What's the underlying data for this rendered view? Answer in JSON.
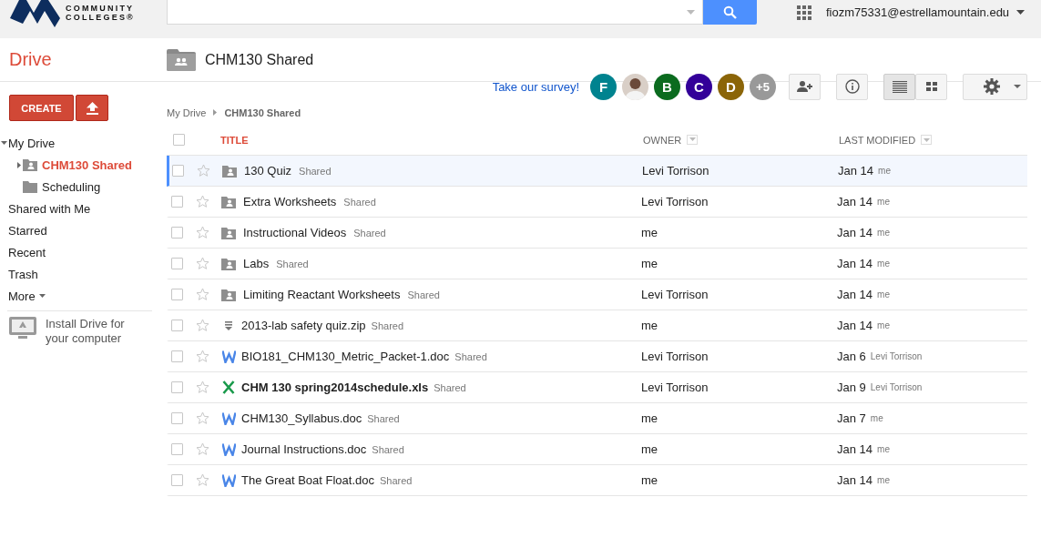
{
  "header": {
    "logo_lines": [
      "COMMUNITY",
      "COLLEGES®"
    ],
    "account": "fiozm75331@estrellamountain.edu"
  },
  "app_title": "Drive",
  "folder_title": "CHM130 Shared",
  "sidebar": {
    "create_label": "CREATE",
    "items": [
      {
        "label": "My Drive",
        "kind": "link",
        "selected": false,
        "expanded": true,
        "children": [
          {
            "label": "CHM130 Shared",
            "kind": "shared-folder",
            "selected": true,
            "expanded": false
          },
          {
            "label": "Scheduling",
            "kind": "folder",
            "selected": false
          }
        ]
      },
      {
        "label": "Shared with Me",
        "kind": "link",
        "selected": false
      },
      {
        "label": "Starred",
        "kind": "link",
        "selected": false
      },
      {
        "label": "Recent",
        "kind": "link",
        "selected": false
      },
      {
        "label": "Trash",
        "kind": "link",
        "selected": false
      },
      {
        "label": "More",
        "kind": "menu",
        "selected": false
      }
    ],
    "install_text": "Install Drive for your computer"
  },
  "toolbar": {
    "survey_link": "Take our survey!",
    "avatars": [
      {
        "kind": "letter",
        "label": "F",
        "color": "#00838f"
      },
      {
        "kind": "photo"
      },
      {
        "kind": "letter",
        "label": "B",
        "color": "#0b6b1f"
      },
      {
        "kind": "letter",
        "label": "C",
        "color": "#330099"
      },
      {
        "kind": "letter",
        "label": "D",
        "color": "#8b6508"
      },
      {
        "kind": "more",
        "label": "+5"
      }
    ],
    "view_modes": [
      {
        "kind": "list",
        "selected": true
      },
      {
        "kind": "grid",
        "selected": false
      }
    ]
  },
  "breadcrumb": [
    "My Drive",
    "CHM130 Shared"
  ],
  "table": {
    "select_all_checked": false,
    "columns": [
      {
        "label": "TITLE",
        "sorted": true
      },
      {
        "label": "OWNER",
        "sorted": false
      },
      {
        "label": "LAST MODIFIED",
        "sorted": false
      }
    ],
    "rows": [
      {
        "kind": "shared-folder",
        "title": "130 Quiz",
        "badge": "Shared",
        "owner": "Levi Torrison",
        "date": "Jan 14",
        "modifier": "me",
        "selected": true,
        "checked": false,
        "starred": false,
        "unread": false
      },
      {
        "kind": "shared-folder",
        "title": "Extra Worksheets",
        "badge": "Shared",
        "owner": "Levi Torrison",
        "date": "Jan 14",
        "modifier": "me",
        "selected": false,
        "checked": false,
        "starred": false,
        "unread": false
      },
      {
        "kind": "shared-folder",
        "title": "Instructional Videos",
        "badge": "Shared",
        "owner": "me",
        "date": "Jan 14",
        "modifier": "me",
        "selected": false,
        "checked": false,
        "starred": false,
        "unread": false
      },
      {
        "kind": "shared-folder",
        "title": "Labs",
        "badge": "Shared",
        "owner": "me",
        "date": "Jan 14",
        "modifier": "me",
        "selected": false,
        "checked": false,
        "starred": false,
        "unread": false
      },
      {
        "kind": "shared-folder",
        "title": "Limiting Reactant Worksheets",
        "badge": "Shared",
        "owner": "Levi Torrison",
        "date": "Jan 14",
        "modifier": "me",
        "selected": false,
        "checked": false,
        "starred": false,
        "unread": false
      },
      {
        "kind": "zip",
        "title": "2013-lab safety quiz.zip",
        "badge": "Shared",
        "owner": "me",
        "date": "Jan 14",
        "modifier": "me",
        "selected": false,
        "checked": false,
        "starred": false,
        "unread": false
      },
      {
        "kind": "doc",
        "title": "BIO181_CHM130_Metric_Packet-1.doc",
        "badge": "Shared",
        "owner": "Levi Torrison",
        "date": "Jan 6",
        "modifier": "Levi Torrison",
        "selected": false,
        "checked": false,
        "starred": false,
        "unread": false
      },
      {
        "kind": "sheet",
        "title": "CHM 130 spring2014schedule.xls",
        "badge": "Shared",
        "owner": "Levi Torrison",
        "date": "Jan 9",
        "modifier": "Levi Torrison",
        "selected": false,
        "checked": false,
        "starred": false,
        "unread": true
      },
      {
        "kind": "doc",
        "title": "CHM130_Syllabus.doc",
        "badge": "Shared",
        "owner": "me",
        "date": "Jan 7",
        "modifier": "me",
        "selected": false,
        "checked": false,
        "starred": false,
        "unread": false
      },
      {
        "kind": "doc",
        "title": "Journal Instructions.doc",
        "badge": "Shared",
        "owner": "me",
        "date": "Jan 14",
        "modifier": "me",
        "selected": false,
        "checked": false,
        "starred": false,
        "unread": false
      },
      {
        "kind": "doc",
        "title": "The Great Boat Float.doc",
        "badge": "Shared",
        "owner": "me",
        "date": "Jan 14",
        "modifier": "me",
        "selected": false,
        "checked": false,
        "starred": false,
        "unread": false
      }
    ]
  }
}
